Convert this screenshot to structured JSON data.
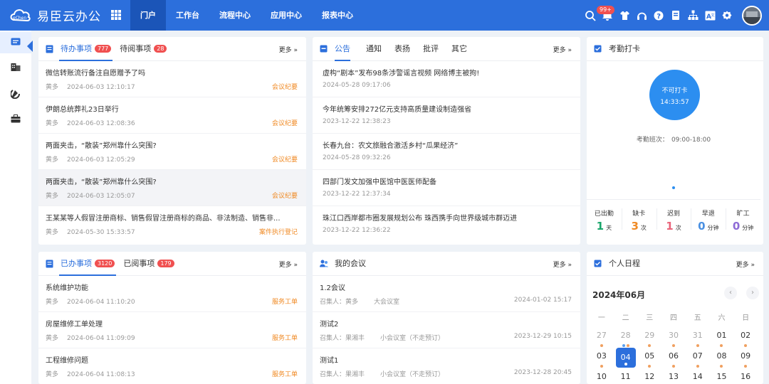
{
  "app": {
    "title": "易臣云办公"
  },
  "nav": [
    "门户",
    "工作台",
    "流程中心",
    "应用中心",
    "报表中心"
  ],
  "header": {
    "notif_count": "99+"
  },
  "todo": {
    "tabs": [
      {
        "label": "待办事项",
        "count": "777"
      },
      {
        "label": "待阅事项",
        "count": "28"
      }
    ],
    "more": "更多",
    "items": [
      {
        "title": "微信转账流行备注自愿赠予了吗",
        "user": "黄多",
        "time": "2024-06-03 12:10:17",
        "tag": "会议纪要"
      },
      {
        "title": "伊朗总统葬礼23日举行",
        "user": "黄多",
        "time": "2024-06-03 12:08:36",
        "tag": "会议纪要"
      },
      {
        "title": "两面夹击，“散装”郑州靠什么突围?",
        "user": "黄多",
        "time": "2024-06-03 12:05:29",
        "tag": "会议纪要"
      },
      {
        "title": "两面夹击，“散装”郑州靠什么突围?",
        "user": "黄多",
        "time": "2024-06-03 12:05:07",
        "tag": "会议纪要"
      },
      {
        "title": "王某某等人假冒注册商标、销售假冒注册商标的商品、非法制造、销售非...",
        "user": "黄多",
        "time": "2024-05-30 15:33:57",
        "tag": "案件执行登记"
      }
    ]
  },
  "notice": {
    "tabs": [
      "公告",
      "通知",
      "表扬",
      "批评",
      "其它"
    ],
    "more": "更多",
    "items": [
      {
        "title": "虚构“剧本”发布98条涉警谣言视频 网络博主被拘!",
        "time": "2024-05-28 09:17:06"
      },
      {
        "title": "今年统筹安排272亿元支持高质量建设制造强省",
        "time": "2023-12-22 12:38:23"
      },
      {
        "title": "长春九台：农文旅融合激活乡村“瓜果经济”",
        "time": "2024-05-28 09:32:26"
      },
      {
        "title": "四部门发文加强中医馆中医医师配备",
        "time": "2023-12-22 12:37:34"
      },
      {
        "title": "珠江口西岸都市圈发展规划公布 珠西携手向世界级城市群迈进",
        "time": "2023-12-22 12:36:22"
      }
    ]
  },
  "attendance": {
    "title": "考勤打卡",
    "status": "不可打卡",
    "time": "14:33:57",
    "shift_label": "考勤班次：",
    "shift": "09:00-18:00",
    "stats": [
      {
        "label": "已出勤",
        "value": "1",
        "unit": "天",
        "color": "#1aa56b"
      },
      {
        "label": "缺卡",
        "value": "3",
        "unit": "次",
        "color": "#f08a24"
      },
      {
        "label": "迟到",
        "value": "1",
        "unit": "次",
        "color": "#e9647a"
      },
      {
        "label": "早退",
        "value": "0",
        "unit": "分钟",
        "color": "#4a90e2"
      },
      {
        "label": "旷工",
        "value": "0",
        "unit": "分钟",
        "color": "#8e6bd6"
      }
    ]
  },
  "done": {
    "tabs": [
      {
        "label": "已办事项",
        "count": "3120"
      },
      {
        "label": "已阅事项",
        "count": "179"
      }
    ],
    "more": "更多",
    "items": [
      {
        "title": "系统维护功能",
        "user": "黄多",
        "time": "2024-06-04 11:10:20",
        "tag": "服务工单"
      },
      {
        "title": "房屋维修工单处理",
        "user": "黄多",
        "time": "2024-06-04 11:09:09",
        "tag": "服务工单"
      },
      {
        "title": "工程维修问题",
        "user": "黄多",
        "time": "2024-06-04 11:08:13",
        "tag": "服务工单"
      }
    ]
  },
  "meeting": {
    "title": "我的会议",
    "more": "更多",
    "items": [
      {
        "title": "1.2会议",
        "host": "召集人：黄多",
        "room": "大会议室",
        "time": "2024-01-02 15:17"
      },
      {
        "title": "测试2",
        "host": "召集人：果湘丰",
        "room": "小会议室（不走预订）",
        "time": "2023-12-29 10:15"
      },
      {
        "title": "测试1",
        "host": "召集人：果湘丰",
        "room": "小会议室（不走预订）",
        "time": "2023-12-28 20:45"
      }
    ]
  },
  "schedule": {
    "title": "个人日程",
    "more": "更多",
    "month": "2024年06月",
    "weekdays": [
      "一",
      "二",
      "三",
      "四",
      "五",
      "六",
      "日"
    ],
    "row1": [
      "27",
      "28",
      "29",
      "30",
      "31",
      "01",
      "02"
    ],
    "row2": [
      "03",
      "04",
      "05",
      "06",
      "07",
      "08",
      "09"
    ],
    "row3": [
      "10",
      "11",
      "12",
      "13",
      "14",
      "15",
      "16"
    ]
  }
}
